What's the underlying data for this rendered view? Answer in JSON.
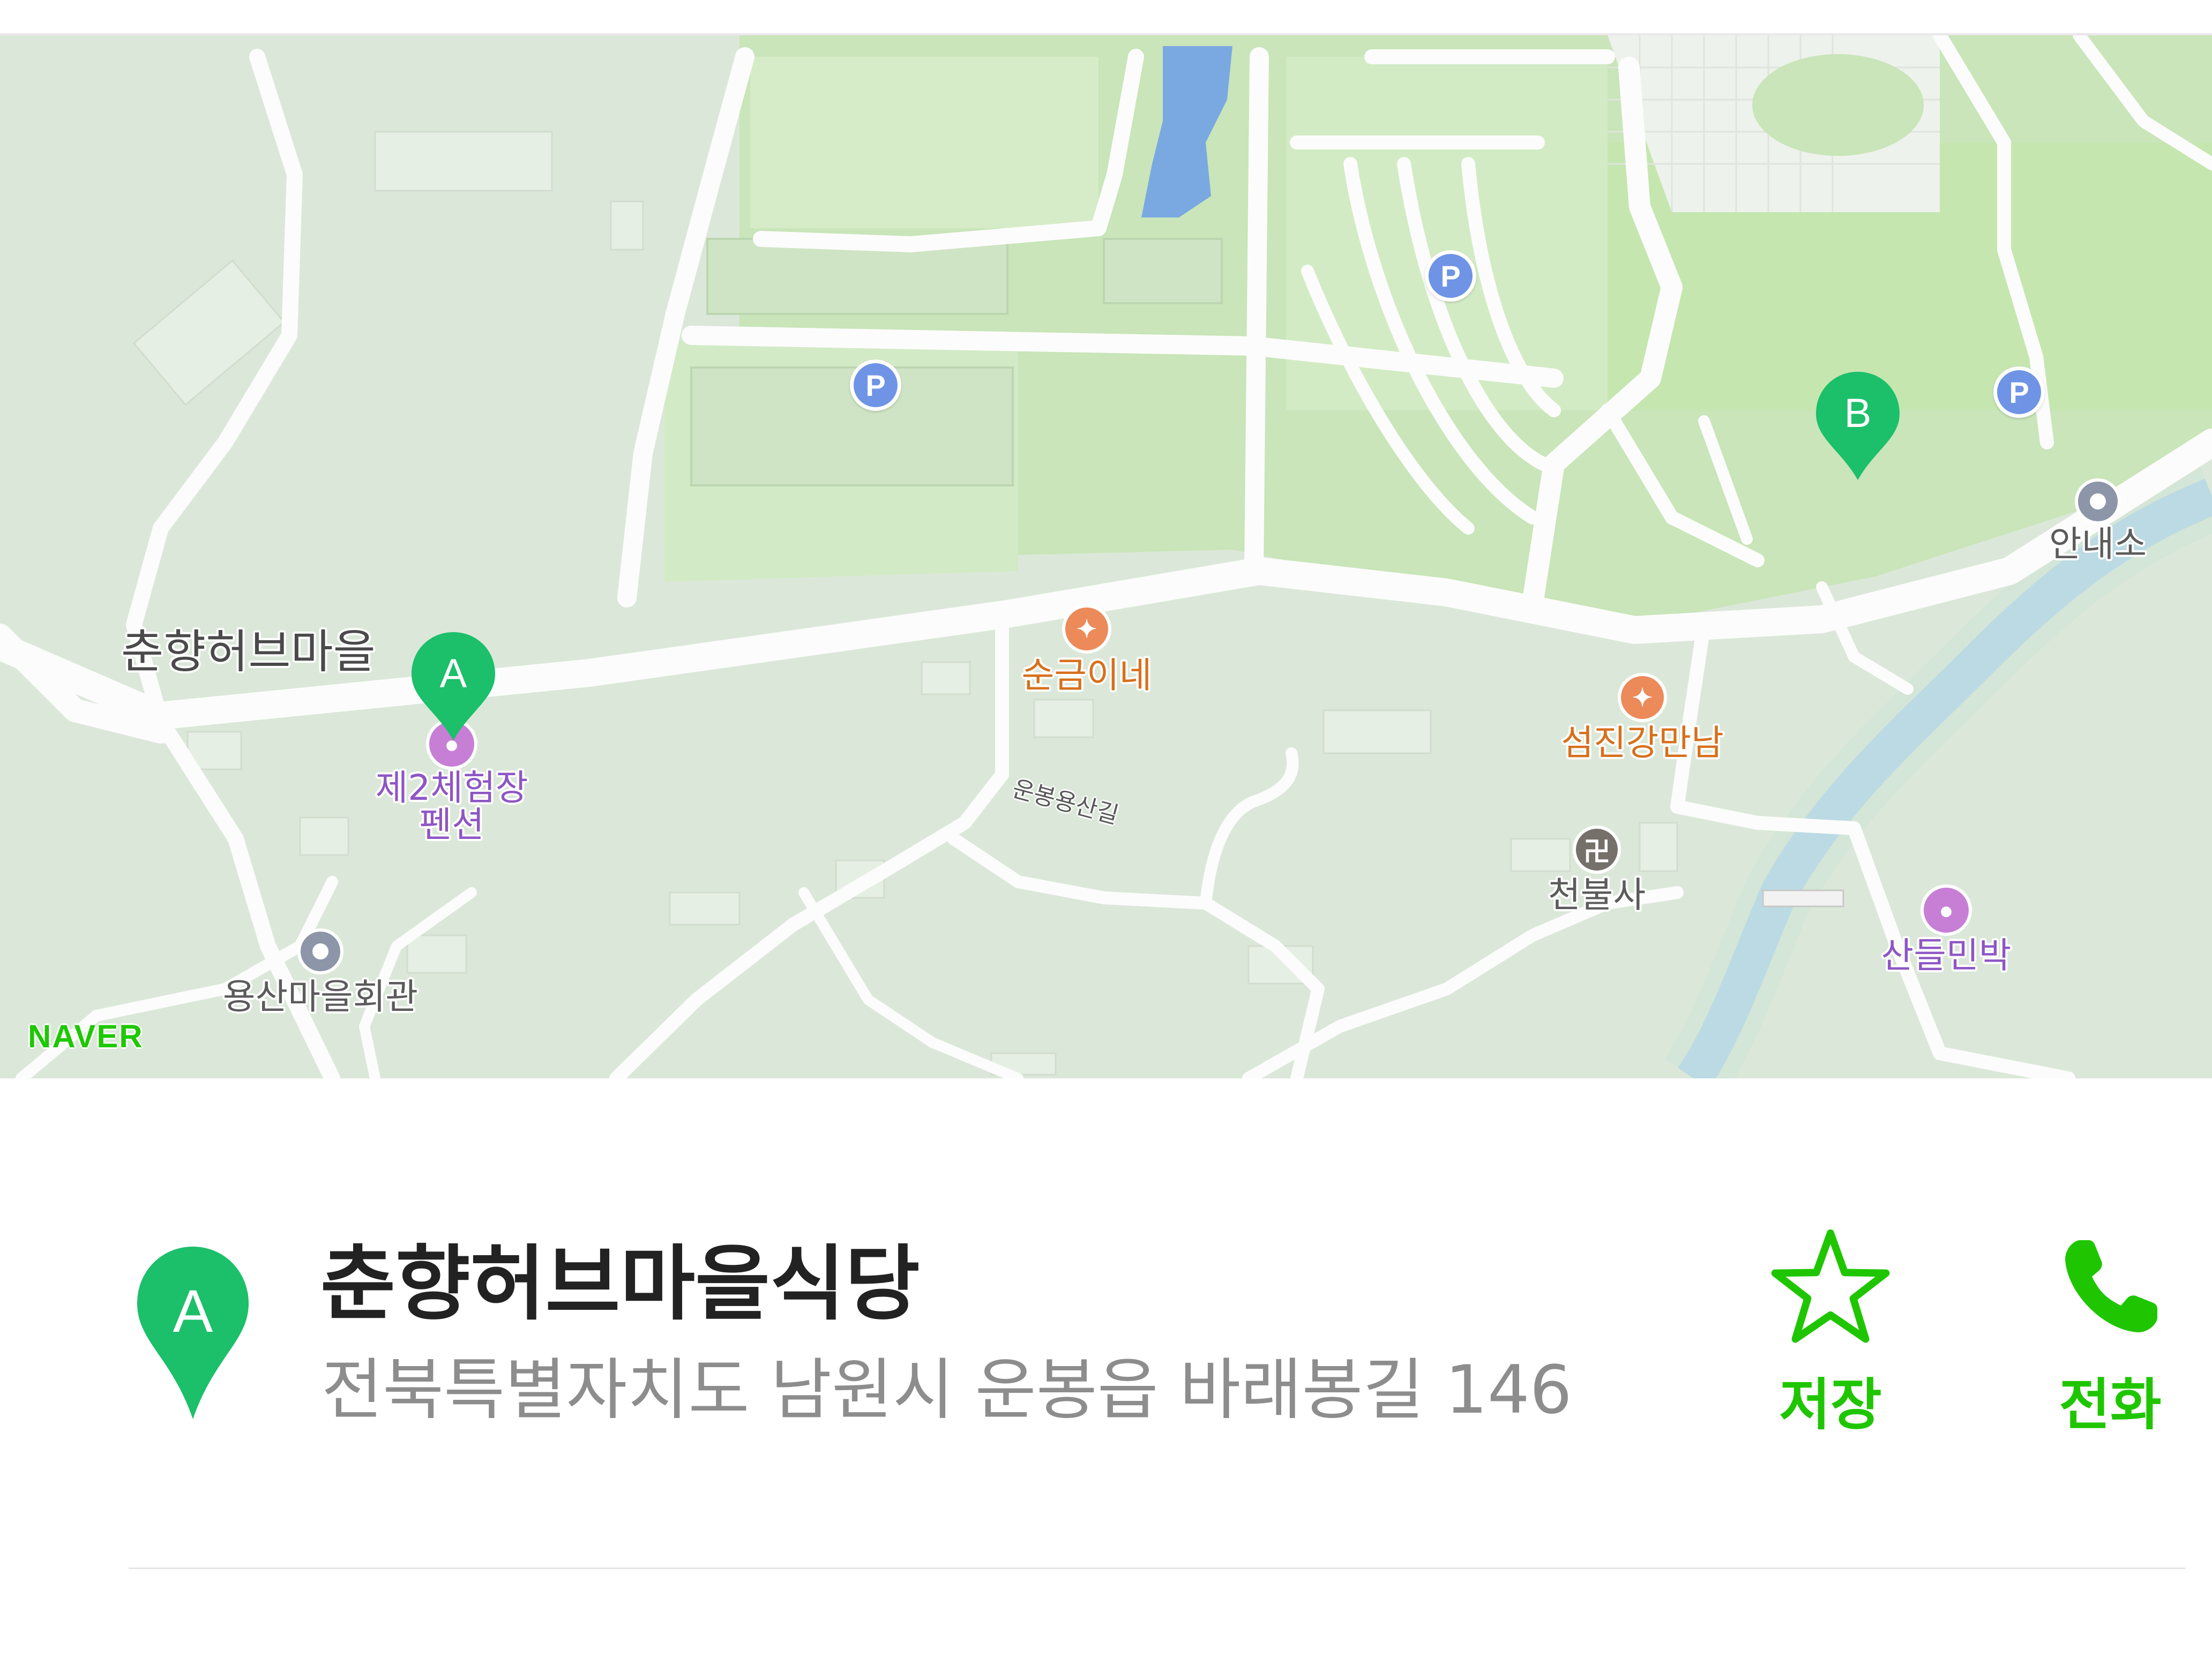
{
  "map": {
    "provider_logo": "NAVER",
    "area_label": "춘향허브마을",
    "road_label": "운봉용산길",
    "markers": [
      {
        "letter": "A",
        "color": "#1cbf6a"
      },
      {
        "letter": "B",
        "color": "#1cbf6a"
      }
    ],
    "pois": [
      {
        "id": "pension",
        "name": "제2체험장\n펜션",
        "icon": "lodging-icon",
        "color": "#8e56c4"
      },
      {
        "id": "hall",
        "name": "용산마을회관",
        "icon": "info-circle-icon",
        "color": "#5b5b5b"
      },
      {
        "id": "restaurant1",
        "name": "순금이네",
        "icon": "restaurant-icon",
        "color": "#d7701c"
      },
      {
        "id": "restaurant2",
        "name": "섬진강만남",
        "icon": "restaurant-icon",
        "color": "#d7701c"
      },
      {
        "id": "temple",
        "name": "천불사",
        "icon": "temple-icon",
        "color": "#5b5b5b"
      },
      {
        "id": "minbak",
        "name": "산들민박",
        "icon": "lodging-icon",
        "color": "#8e56c4"
      },
      {
        "id": "info",
        "name": "안내소",
        "icon": "info-circle-icon",
        "color": "#5b5b5b"
      }
    ],
    "parking_symbol": "P",
    "colors": {
      "land": "#dbe8d9",
      "park": "#c4e3b4",
      "road": "#fcfcfc",
      "river": "#9ec9ef",
      "water": "#7aa9e1",
      "marker": "#1cbf6a"
    }
  },
  "place": {
    "marker_letter": "A",
    "name": "춘향허브마을식당",
    "address": "전북특별자치도 남원시 운봉읍 바래봉길 146"
  },
  "actions": {
    "save_label": "저장",
    "save_icon": "star-outline-icon",
    "call_label": "전화",
    "call_icon": "phone-icon",
    "accent": "#1fc600"
  }
}
